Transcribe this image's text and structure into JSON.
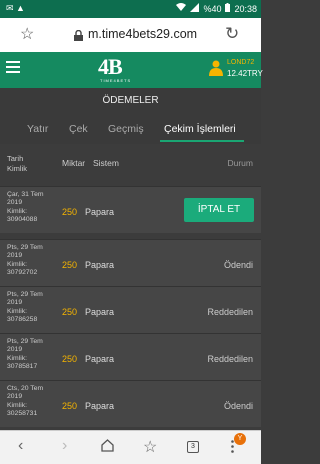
{
  "status_bar": {
    "left_icons": "✉ ▲",
    "battery": "%40",
    "time": "20:38"
  },
  "browser": {
    "url": "m.time4bets29.com"
  },
  "header": {
    "logo": "4B",
    "logo_sub": "TIME4BETS",
    "username": "LOND72",
    "balance": "12.42TRY"
  },
  "page_title": "ÖDEMELER",
  "tabs": [
    {
      "label": "Yatır",
      "active": false
    },
    {
      "label": "Çek",
      "active": false
    },
    {
      "label": "Geçmiş",
      "active": false
    },
    {
      "label": "Çekim İşlemleri",
      "active": true
    }
  ],
  "table": {
    "headers": {
      "date_line1": "Tarih",
      "date_line2": "Kimlik",
      "amount": "Miktar",
      "system": "Sistem",
      "status": "Durum"
    },
    "rows": [
      {
        "date": "Çar, 31 Tem 2019",
        "id_label": "Kimlik:",
        "id": "30904088",
        "amount": "250",
        "system": "Papara",
        "status": "",
        "action": "İPTAL ET"
      },
      {
        "date": "Pts, 29 Tem 2019",
        "id_label": "Kimlik:",
        "id": "30792702",
        "amount": "250",
        "system": "Papara",
        "status": "Ödendi",
        "action": ""
      },
      {
        "date": "Pts, 29 Tem 2019",
        "id_label": "Kimlik:",
        "id": "30786258",
        "amount": "250",
        "system": "Papara",
        "status": "Reddedilen",
        "action": ""
      },
      {
        "date": "Pts, 29 Tem 2019",
        "id_label": "Kimlik:",
        "id": "30785817",
        "amount": "250",
        "system": "Papara",
        "status": "Reddedilen",
        "action": ""
      },
      {
        "date": "Cts, 20 Tem 2019",
        "id_label": "Kimlik:",
        "id": "30258731",
        "amount": "250",
        "system": "Papara",
        "status": "Ödendi",
        "action": ""
      }
    ]
  },
  "bottom_nav": {
    "tab_count": "3",
    "badge": "Y"
  },
  "colors": {
    "header_green": "#158a60",
    "button_green": "#1bab7b",
    "amount_yellow": "#f5b400"
  }
}
